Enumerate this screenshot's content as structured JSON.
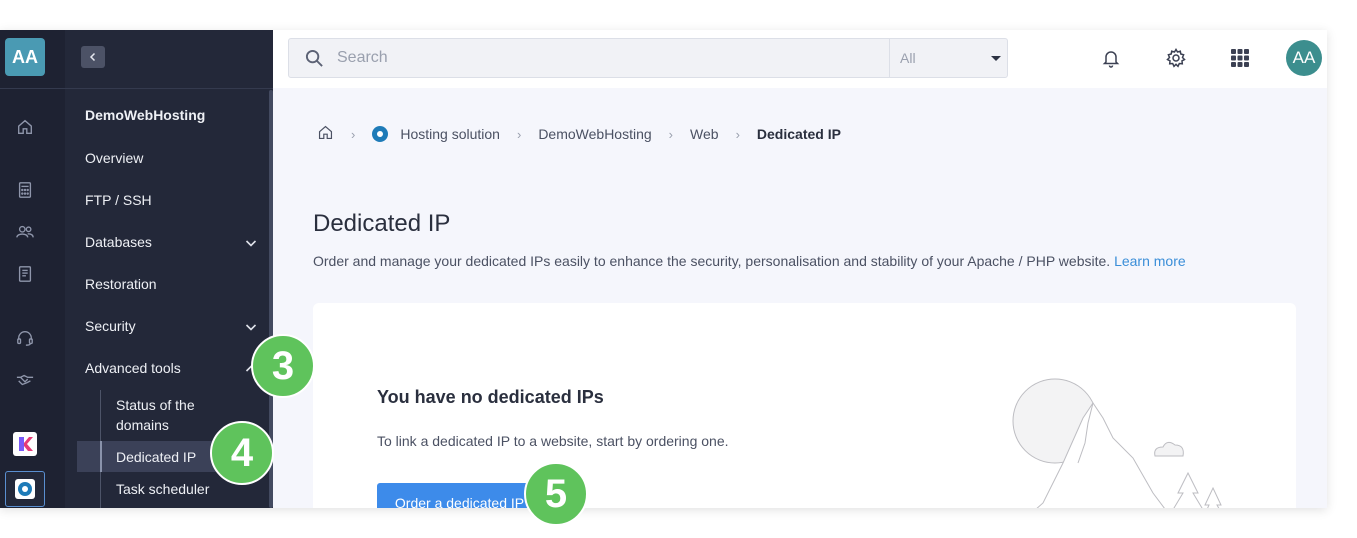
{
  "rail": {
    "account_initials": "AA",
    "icons": [
      "home-icon",
      "calculator-icon",
      "users-icon",
      "receipt-icon",
      "headset-icon",
      "handshake-icon"
    ],
    "apps": [
      "kdrive-app-icon",
      "web-hosting-app-icon"
    ]
  },
  "sidebar": {
    "collapse_icon": "chevron-left-icon",
    "title": "DemoWebHosting",
    "items": [
      {
        "label": "Overview"
      },
      {
        "label": "FTP / SSH"
      },
      {
        "label": "Databases",
        "chevron": "down"
      },
      {
        "label": "Restoration"
      },
      {
        "label": "Security",
        "chevron": "down"
      },
      {
        "label": "Advanced tools",
        "chevron": "up"
      }
    ],
    "subitems": [
      {
        "label": "Status of the domains"
      },
      {
        "label": "Dedicated IP",
        "active": true
      },
      {
        "label": "Task scheduler"
      }
    ]
  },
  "topbar": {
    "search": {
      "placeholder": "Search",
      "value": ""
    },
    "scope": {
      "selected": "All"
    },
    "icons": [
      "bell-icon",
      "gear-icon",
      "apps-grid-icon"
    ],
    "user_initials": "AA"
  },
  "breadcrumb": {
    "items": [
      "Hosting solution",
      "DemoWebHosting",
      "Web",
      "Dedicated IP"
    ]
  },
  "page": {
    "title": "Dedicated IP",
    "description": "Order and manage your dedicated IPs easily to enhance the security, personalisation and stability of your Apache / PHP website.",
    "learn_more": "Learn more"
  },
  "empty_state": {
    "title": "You have no dedicated IPs",
    "text": "To link a dedicated IP to a website, start by ordering one.",
    "button": "Order a dedicated IP"
  },
  "annotations": {
    "step3": "3",
    "step4": "4",
    "step5": "5"
  },
  "colors": {
    "rail_bg": "#1e2232",
    "sidebar_bg": "#232839",
    "accent": "#3d8bea",
    "step_badge": "#5fc35c",
    "avatar": "#3c8e8e"
  }
}
